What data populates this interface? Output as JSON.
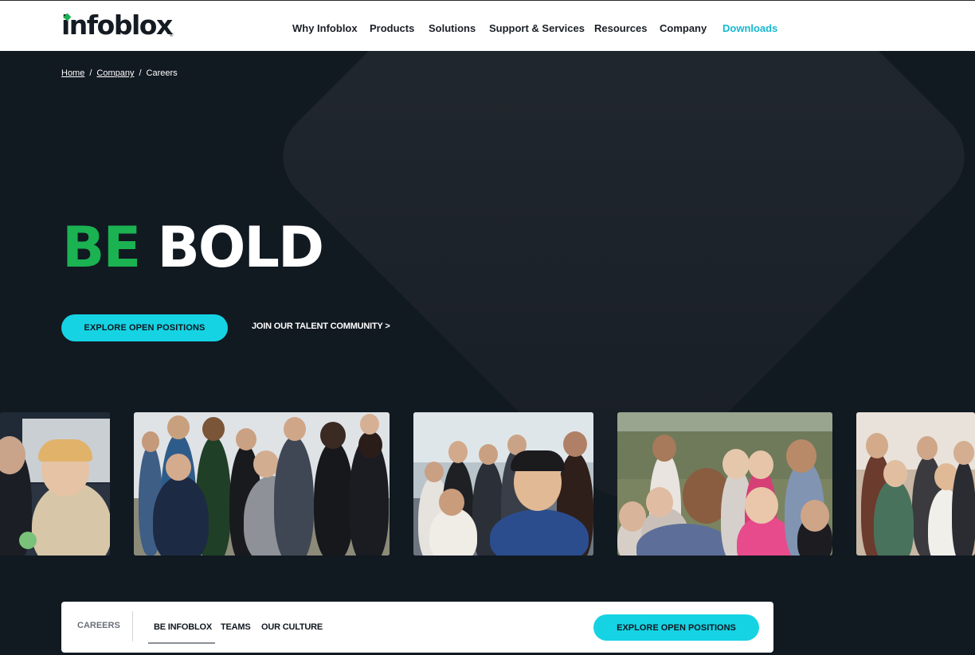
{
  "header": {
    "logo_text": "infoblox",
    "logo_reg": "®",
    "nav": [
      {
        "label": "Why Infoblox"
      },
      {
        "label": "Products"
      },
      {
        "label": "Solutions"
      },
      {
        "label": "Support & Services"
      },
      {
        "label": "Resources"
      },
      {
        "label": "Company"
      },
      {
        "label": "Downloads"
      }
    ]
  },
  "breadcrumb": {
    "items": [
      "Home",
      "Company",
      "Careers"
    ],
    "separator": "/"
  },
  "hero": {
    "headline_accent": "BE",
    "headline_rest": "BOLD",
    "primary_cta": "EXPLORE OPEN POSITIONS",
    "secondary_cta": "JOIN OUR TALENT COMMUNITY >"
  },
  "photos": [
    {
      "name": "team-photo-poster"
    },
    {
      "name": "team-photo-office-group"
    },
    {
      "name": "team-photo-selfie-atrium"
    },
    {
      "name": "team-photo-rooftop-selfie"
    },
    {
      "name": "team-photo-celebration"
    }
  ],
  "subnav": {
    "label": "CAREERS",
    "tabs": [
      "BE INFOBLOX",
      "TEAMS",
      "OUR CULTURE"
    ],
    "active_tab": "BE INFOBLOX",
    "cta": "EXPLORE OPEN POSITIONS"
  },
  "colors": {
    "accent_green": "#1bb252",
    "accent_cyan": "#16d3e3",
    "link_cyan": "#16b8d0",
    "background": "#111921"
  }
}
